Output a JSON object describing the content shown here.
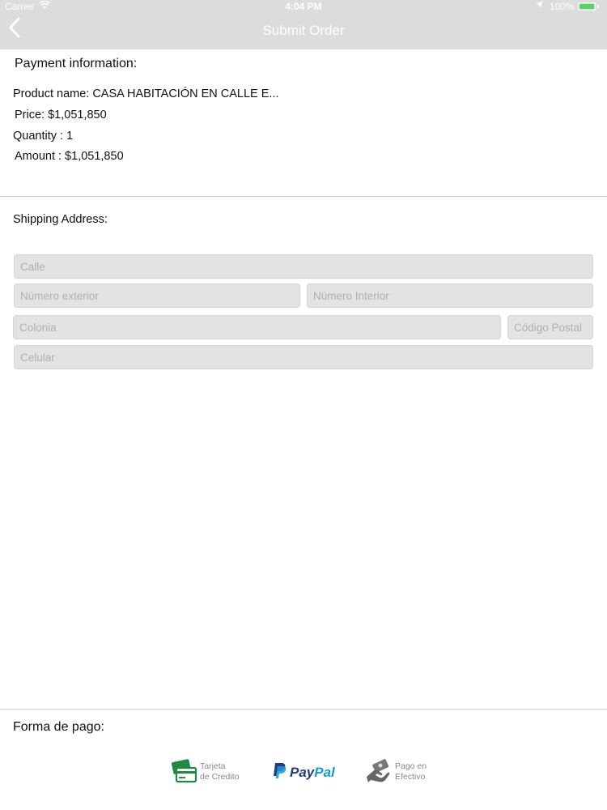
{
  "status_bar": {
    "carrier": "Carrier",
    "time": "4:04 PM",
    "battery_percent": "100%",
    "battery_level": 1.0
  },
  "navbar": {
    "title": "Submit Order",
    "back_icon": "chevron-left-icon"
  },
  "payment_info": {
    "heading": "Payment information:",
    "product_name": "Product name: CASA HABITACIÓN EN CALLE E...",
    "price": "Price: $1,051,850",
    "quantity": "Quantity : 1",
    "amount": "Amount : $1,051,850"
  },
  "shipping": {
    "heading": "Shipping Address:",
    "calle_placeholder": "Calle",
    "numero_exterior_placeholder": "Número exterior",
    "numero_interior_placeholder": "Número Interior",
    "colonia_placeholder": "Colonia",
    "codigo_postal_placeholder": "Código Postal",
    "celular_placeholder": "Celular"
  },
  "payment_methods": {
    "heading": "Forma de pago:",
    "card_line1": "Tarjeta",
    "card_line2": "de Credito",
    "paypal_pay": "Pay",
    "paypal_pal": "Pal",
    "cash_line1": "Pago en",
    "cash_line2": "Efectivo"
  },
  "colors": {
    "bar_background": "#dcdcdc",
    "field_background": "#e3e3e3",
    "card_green": "#1e8a44",
    "paypal_dark": "#253b80",
    "paypal_light": "#179bd7",
    "battery_green": "#4cd964"
  }
}
